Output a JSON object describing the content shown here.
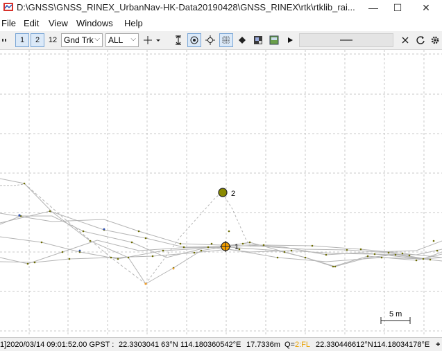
{
  "window": {
    "title": "D:\\GNSS\\GNSS_RINEX_UrbanNav-HK-Data20190428\\GNSS_RINEX\\rtk\\rtklib_rai...",
    "minimize_glyph": "—",
    "maximize_glyph": "☐",
    "close_glyph": "✕"
  },
  "menu": {
    "file": "File",
    "edit": "Edit",
    "view": "View",
    "windows": "Windows",
    "help": "Help"
  },
  "toolbar": {
    "sol1_label": "1",
    "sol2_label": "2",
    "sol12_label": "12",
    "plot_type": "Gnd Trk",
    "quality_filter": "ALL"
  },
  "plot": {
    "marker1_label": "1",
    "marker2_label": "2",
    "scale_label": "5 m",
    "colors": {
      "grid": "#c8c8c8",
      "track": "#b4b4b4",
      "point": "#6b6b00",
      "marker1": "#f5a000",
      "marker2": "#8a8a00",
      "float_point": "#f0a030"
    }
  },
  "status": {
    "time": "1]2020/03/14 09:01:52.00 GPST :",
    "lat1": "22.3303041 63°N",
    "lon1": "114.180360542°E",
    "height": "17.7336m",
    "q_label": "Q=",
    "q_value": "2:FL",
    "lat2": "22.330446612°N",
    "lon2": "114.18034178°E",
    "cursor_glyph": "+"
  }
}
